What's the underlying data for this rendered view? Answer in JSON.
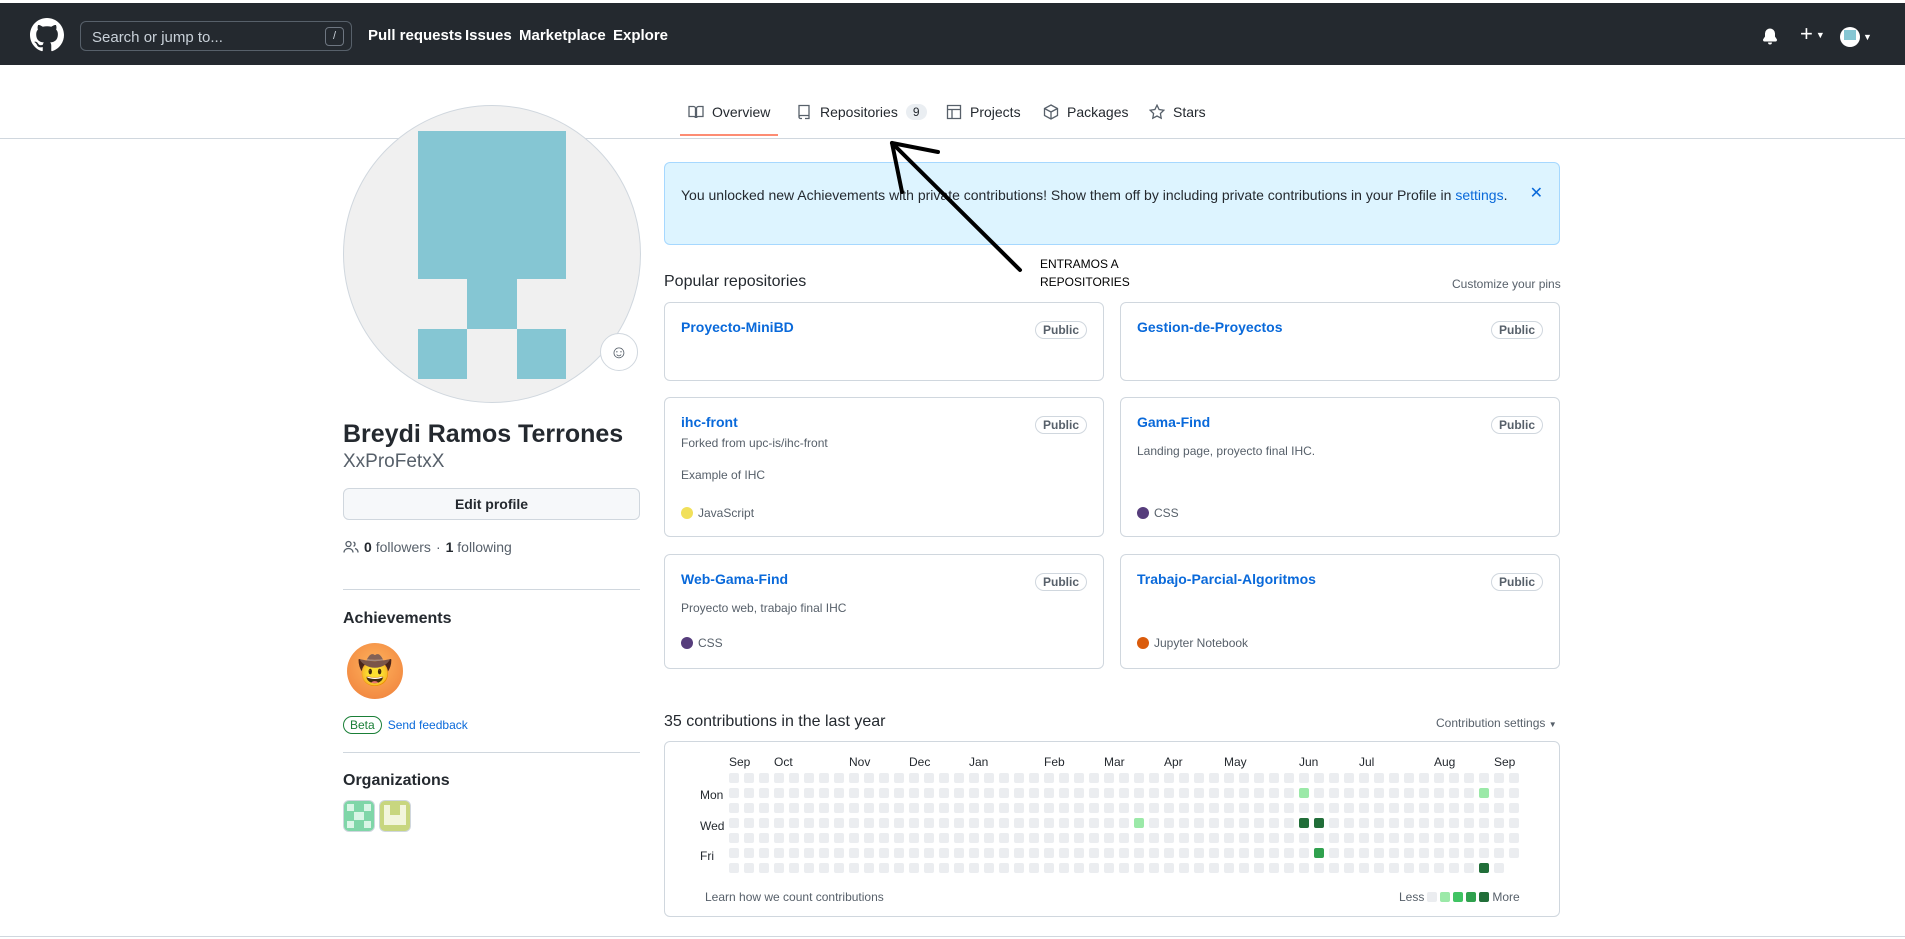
{
  "header": {
    "search_placeholder": "Search or jump to...",
    "search_shortcut": "/",
    "nav": [
      "Pull requests",
      "Issues",
      "Marketplace",
      "Explore"
    ]
  },
  "tabs": {
    "overview": "Overview",
    "repositories": "Repositories",
    "repositories_count": "9",
    "projects": "Projects",
    "packages": "Packages",
    "stars": "Stars"
  },
  "profile": {
    "full_name": "Breydi Ramos Terrones",
    "login": "XxProFetxX",
    "edit_button": "Edit profile",
    "followers_count": "0",
    "followers_label": "followers",
    "separator": "·",
    "following_count": "1",
    "following_label": "following",
    "achievements_heading": "Achievements",
    "beta_tag": "Beta",
    "send_feedback": "Send feedback",
    "organizations_heading": "Organizations"
  },
  "flash": {
    "message": "You unlocked new Achievements with private contributions! Show them off by including private contributions in your Profile in",
    "link": "settings",
    "tail": "."
  },
  "popular": {
    "heading": "Popular repositories",
    "customize": "Customize your pins",
    "repos": [
      {
        "name": "Proyecto-MiniBD",
        "visibility": "Public"
      },
      {
        "name": "Gestion-de-Proyectos",
        "visibility": "Public"
      },
      {
        "name": "ihc-front",
        "visibility": "Public",
        "fork_text": "Forked from upc-is/ihc-front",
        "description": "Example of IHC",
        "language": "JavaScript",
        "language_color": "#f1e05a"
      },
      {
        "name": "Gama-Find",
        "visibility": "Public",
        "description": "Landing page, proyecto final IHC.",
        "language": "CSS",
        "language_color": "#563d7c"
      },
      {
        "name": "Web-Gama-Find",
        "visibility": "Public",
        "description": "Proyecto web, trabajo final IHC",
        "language": "CSS",
        "language_color": "#563d7c"
      },
      {
        "name": "Trabajo-Parcial-Algoritmos",
        "visibility": "Public",
        "language": "Jupyter Notebook",
        "language_color": "#da5b0b"
      }
    ]
  },
  "contributions": {
    "heading": "35 contributions in the last year",
    "settings": "Contribution settings",
    "months": [
      "Sep",
      "Oct",
      "Nov",
      "Dec",
      "Jan",
      "Feb",
      "Mar",
      "Apr",
      "May",
      "Jun",
      "Jul",
      "Aug",
      "Sep"
    ],
    "days": [
      "Mon",
      "Wed",
      "Fri"
    ],
    "learn": "Learn how we count contributions",
    "less": "Less",
    "more": "More",
    "levels": [
      "#ebedf0",
      "#9be9a8",
      "#40c463",
      "#30a14e",
      "#216e39"
    ],
    "active_cells": [
      {
        "week": 27,
        "day": 3,
        "level": 1
      },
      {
        "week": 38,
        "day": 1,
        "level": 1
      },
      {
        "week": 38,
        "day": 3,
        "level": 4
      },
      {
        "week": 39,
        "day": 3,
        "level": 4
      },
      {
        "week": 39,
        "day": 5,
        "level": 3
      },
      {
        "week": 50,
        "day": 1,
        "level": 1
      },
      {
        "week": 50,
        "day": 6,
        "level": 4
      }
    ]
  },
  "annotation": {
    "text": "ENTRAMOS A REPOSITORIES"
  }
}
